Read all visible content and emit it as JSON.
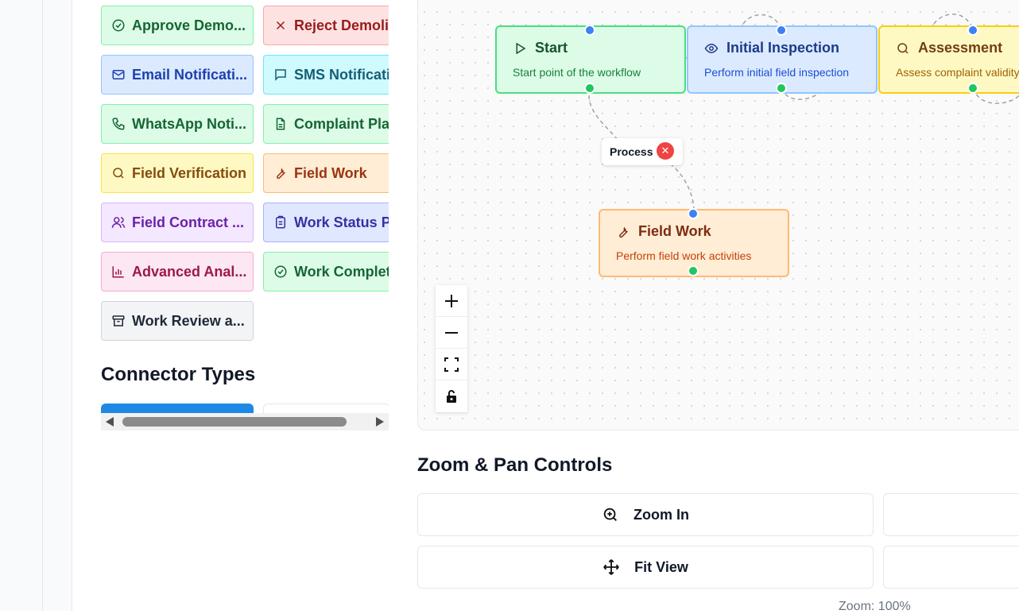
{
  "palette": {
    "nodes": [
      {
        "label": "Approve Demo...",
        "icon": "check-circle-icon",
        "color": "green"
      },
      {
        "label": "Reject Demolit",
        "icon": "x-icon",
        "color": "red"
      },
      {
        "label": "Email Notificati...",
        "icon": "mail-icon",
        "color": "blue"
      },
      {
        "label": "SMS Notificatic",
        "icon": "message-icon",
        "color": "cyan"
      },
      {
        "label": "WhatsApp Noti...",
        "icon": "phone-icon",
        "color": "green"
      },
      {
        "label": "Complaint Plan",
        "icon": "file-text-icon",
        "color": "green"
      },
      {
        "label": "Field Verification",
        "icon": "search-icon",
        "color": "yellow"
      },
      {
        "label": "Field Work",
        "icon": "wrench-icon",
        "color": "orange"
      },
      {
        "label": "Field Contract ...",
        "icon": "users-icon",
        "color": "purple"
      },
      {
        "label": "Work Status Pe",
        "icon": "clipboard-icon",
        "color": "indigo"
      },
      {
        "label": "Advanced Anal...",
        "icon": "bar-chart-icon",
        "color": "pink"
      },
      {
        "label": "Work Completi",
        "icon": "check-circle-icon",
        "color": "green"
      },
      {
        "label": "Work Review a...",
        "icon": "archive-icon",
        "color": "gray"
      }
    ],
    "connector_title": "Connector Types"
  },
  "canvas": {
    "nodes": [
      {
        "title": "Start",
        "desc": "Start point of the workflow",
        "icon": "play-icon",
        "color": "green"
      },
      {
        "title": "Initial Inspection",
        "desc": "Perform initial field inspection",
        "icon": "eye-icon",
        "color": "blue"
      },
      {
        "title": "Assessment",
        "desc": "Assess complaint validity",
        "icon": "search-icon",
        "color": "yellow"
      },
      {
        "title": "Field Work",
        "desc": "Perform field work activities",
        "icon": "wrench-icon",
        "color": "orange"
      }
    ],
    "edge_label": "Process",
    "controls": [
      "zoom-in-icon",
      "zoom-out-icon",
      "fit-view-icon",
      "lock-icon"
    ]
  },
  "zoom_pan": {
    "title": "Zoom & Pan Controls",
    "zoom_in": "Zoom In",
    "fit_view": "Fit View",
    "zoom_readout": "Zoom: 100%"
  }
}
